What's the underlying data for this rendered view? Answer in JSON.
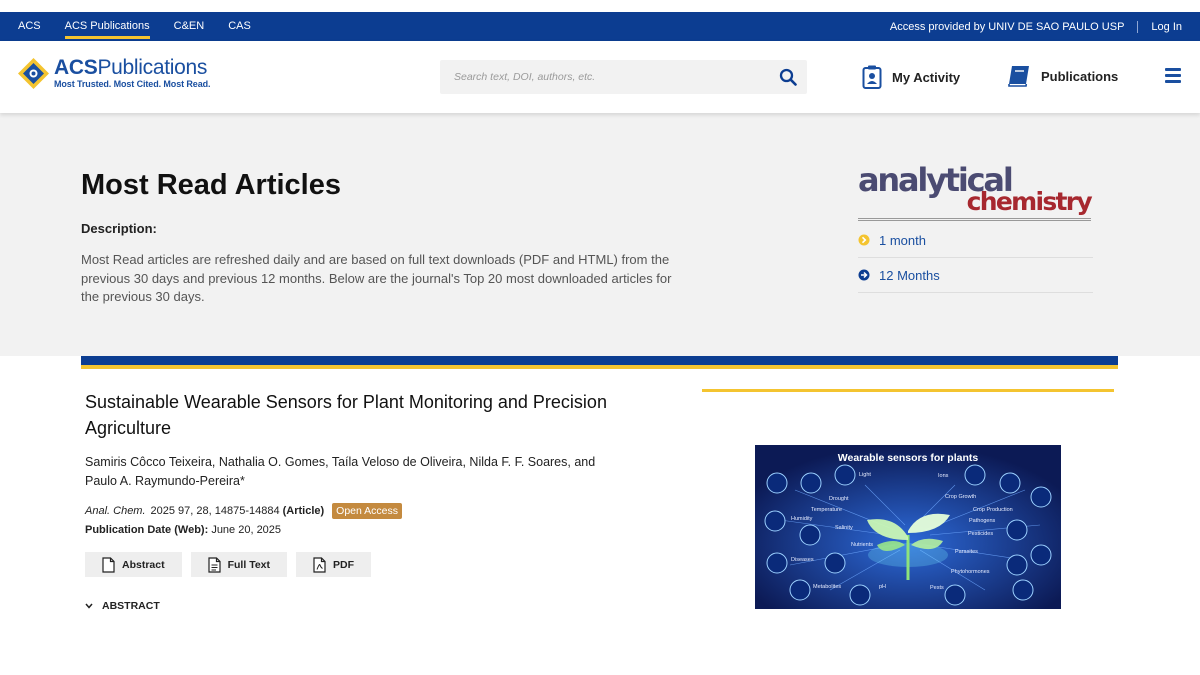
{
  "topbar": {
    "nav": [
      "ACS",
      "ACS Publications",
      "C&EN",
      "CAS"
    ],
    "active_index": 1,
    "access_text": "Access provided by UNIV DE SAO PAULO USP",
    "login_label": "Log In"
  },
  "header": {
    "logo_acs": "ACS",
    "logo_pub": "Publications",
    "logo_tagline": "Most Trusted. Most Cited. Most Read.",
    "search_placeholder": "Search text, DOI, authors, etc.",
    "my_activity_label": "My Activity",
    "publications_label": "Publications"
  },
  "hero": {
    "title": "Most Read Articles",
    "description_label": "Description:",
    "description_text": "Most Read articles are refreshed daily and are based on full text downloads (PDF and HTML) from the previous 30 days and previous 12 months. Below are the journal's Top 20 most downloaded articles for the previous 30 days.",
    "journal_logo_line1": "analytical",
    "journal_logo_line2": "chemistry",
    "periods": [
      "1 month",
      "12 Months"
    ]
  },
  "article": {
    "title": "Sustainable Wearable Sensors for Plant Monitoring and Precision Agriculture",
    "authors": "Samiris Côcco Teixeira, Nathalia O. Gomes, Taíla Veloso de Oliveira, Nilda F. F. Soares, and Paulo A. Raymundo-Pereira*",
    "journal": "Anal. Chem.",
    "citation": "2025 97, 28, 14875-14884",
    "type": "(Article)",
    "badge": "Open Access",
    "pub_date_label": "Publication Date (Web):",
    "pub_date": "June 20, 2025",
    "buttons": [
      "Abstract",
      "Full Text",
      "PDF"
    ],
    "abstract_toggle": "ABSTRACT",
    "toc_title": "Wearable sensors for plants",
    "toc_labels": [
      "Light",
      "Ions",
      "Drought",
      "Crop Growth",
      "Temperature",
      "Crop Production",
      "Humidity",
      "Pathogens",
      "Salinity",
      "Pesticides",
      "Nutrients",
      "Parasites",
      "Diseases",
      "Phytohormones",
      "Metabolites",
      "pH",
      "Pests"
    ]
  },
  "colors": {
    "brand_blue": "#0c3d91",
    "accent_gold": "#f4c430",
    "oa_badge": "#c48a3f"
  }
}
